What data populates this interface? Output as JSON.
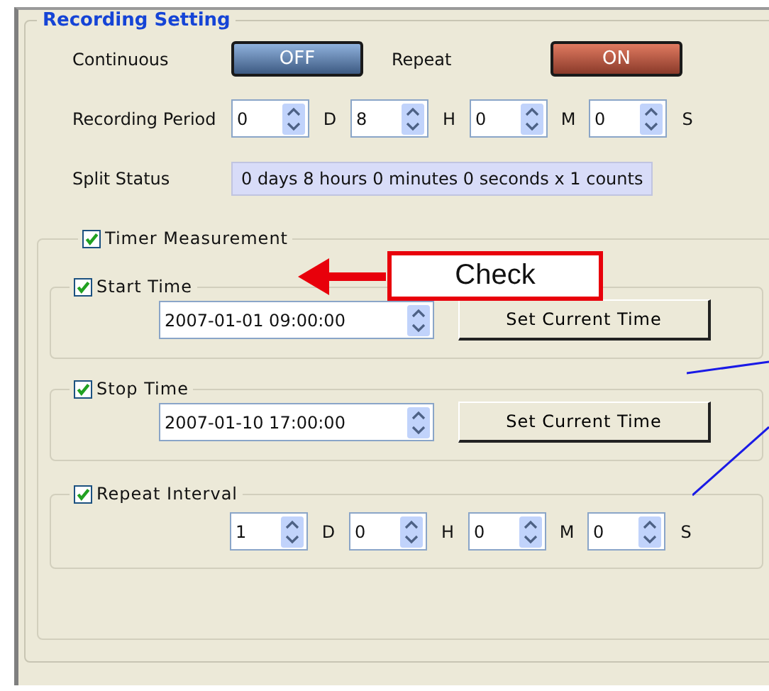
{
  "group_title": "Recording Setting",
  "toggles": [
    {
      "label": "Continuous",
      "text": "OFF",
      "on": false
    },
    {
      "label": "Repeat",
      "text": "ON",
      "on": true
    }
  ],
  "recording_period": {
    "label": "Recording Period",
    "fields": [
      {
        "value": "0",
        "unit": "D"
      },
      {
        "value": "8",
        "unit": "H"
      },
      {
        "value": "0",
        "unit": "M"
      },
      {
        "value": "0",
        "unit": "S"
      }
    ]
  },
  "split_status": {
    "label": "Split Status",
    "value": "0 days 8 hours 0 minutes 0 seconds x 1 counts"
  },
  "timer_measurement": {
    "label": "Timer Measurement",
    "checked": true,
    "times": [
      {
        "label": "Start Time",
        "checked": true,
        "value": "2007-01-01 09:00:00",
        "button": "Set Current Time"
      },
      {
        "label": "Stop Time",
        "checked": true,
        "value": "2007-01-10 17:00:00",
        "button": "Set Current Time"
      }
    ],
    "repeat_interval": {
      "label": "Repeat Interval",
      "checked": true,
      "fields": [
        {
          "value": "1",
          "unit": "D"
        },
        {
          "value": "0",
          "unit": "H"
        },
        {
          "value": "0",
          "unit": "M"
        },
        {
          "value": "0",
          "unit": "S"
        }
      ]
    }
  },
  "callout": {
    "text": "Check"
  }
}
